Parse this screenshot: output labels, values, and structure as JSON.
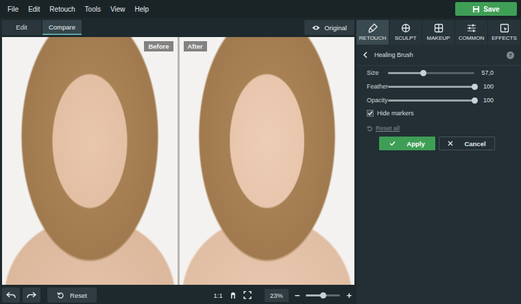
{
  "window": {
    "title": "Photo retouch editor"
  },
  "menu": [
    "File",
    "Edit",
    "Retouch",
    "Tools",
    "View",
    "Help"
  ],
  "save_button": {
    "label": "Save"
  },
  "view_tabs": [
    {
      "label": "Edit",
      "selected": false
    },
    {
      "label": "Compare",
      "selected": true
    }
  ],
  "original_button": {
    "label": "Original"
  },
  "panel_tabs": [
    {
      "label": "RETOUCH",
      "selected": true,
      "kind": "brush"
    },
    {
      "label": "SCULPT",
      "selected": false,
      "kind": "sculpt"
    },
    {
      "label": "MAKEUP",
      "selected": false,
      "kind": "makeup"
    },
    {
      "label": "COMMON",
      "selected": false,
      "kind": "common"
    },
    {
      "label": "EFFECTS",
      "selected": false,
      "kind": "effects"
    }
  ],
  "canvas": {
    "before_label": "Before",
    "after_label": "After"
  },
  "tool": {
    "title": "Healing Brush",
    "help": "?"
  },
  "sliders": [
    {
      "label": "Size",
      "value": "57,0",
      "level": 0.41
    },
    {
      "label": "Feather",
      "value": "100",
      "level": 1.0
    },
    {
      "label": "Opacity",
      "value": "100",
      "level": 1.0
    }
  ],
  "options": [
    {
      "label": "Hide markers",
      "checked": true
    }
  ],
  "reset_all": {
    "label": "Reset all",
    "disabled": true
  },
  "actions": [
    {
      "label": "Apply",
      "kind": "primary"
    },
    {
      "label": "Cancel",
      "kind": "secondary"
    }
  ],
  "bottom_bar": {
    "reset": "Reset",
    "ratio": "1:1",
    "zoom": "23%",
    "zoom_level": 0.5,
    "zoom_out": "−",
    "zoom_in": "+"
  }
}
